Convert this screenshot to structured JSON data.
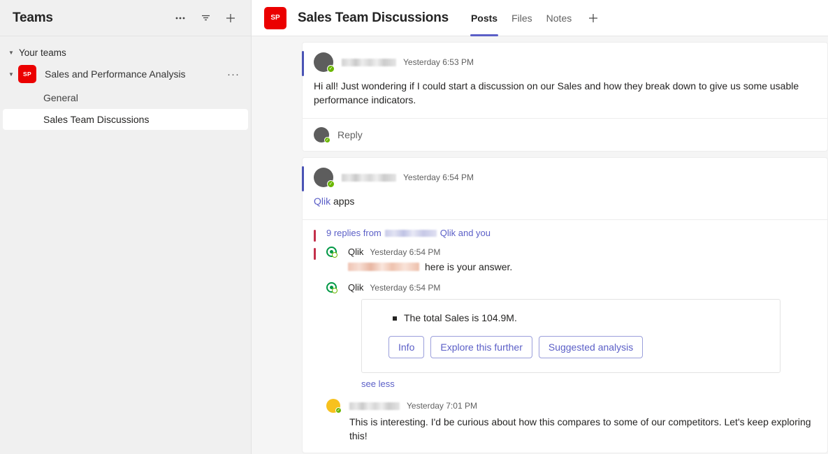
{
  "sidebar": {
    "title": "Teams",
    "actions": [
      {
        "name": "more-options-icon",
        "glyph": "···"
      },
      {
        "name": "filter-icon",
        "glyph": "filter"
      },
      {
        "name": "add-team-icon",
        "glyph": "+"
      }
    ],
    "group_label": "Your teams",
    "team": {
      "initials": "SP",
      "name": "Sales and Performance Analysis",
      "more_label": "···",
      "avatar_color": "#eb0000"
    },
    "channels": [
      {
        "label": "General",
        "selected": false
      },
      {
        "label": "Sales Team Discussions",
        "selected": true
      }
    ]
  },
  "header": {
    "avatar_initials": "SP",
    "title": "Sales Team Discussions",
    "tabs": [
      {
        "label": "Posts",
        "active": true
      },
      {
        "label": "Files",
        "active": false
      },
      {
        "label": "Notes",
        "active": false
      }
    ],
    "add_tab_glyph": "+",
    "accent_color": "#5b5fc7"
  },
  "conversation": {
    "messages": [
      {
        "author_blurred": true,
        "timestamp": "Yesterday 6:53 PM",
        "text": "Hi all! Just wondering if I could start a discussion on our Sales and how they break down to give us some usable performance indicators.",
        "reply_label": "Reply"
      },
      {
        "author_blurred": true,
        "timestamp": "Yesterday 6:54 PM",
        "text_link": "Qlik",
        "text_rest": " apps"
      }
    ],
    "thread": {
      "replies_prefix": "9 replies from",
      "replies_suffix": "Qlik and you",
      "replies": [
        {
          "author": "Qlik",
          "timestamp": "Yesterday 6:54 PM",
          "text": "here is your answer.",
          "mention_blurred": true
        },
        {
          "author": "Qlik",
          "timestamp": "Yesterday 6:54 PM",
          "card": {
            "bullet": "The total Sales is 104.9M.",
            "buttons": [
              "Info",
              "Explore this further",
              "Suggested analysis"
            ]
          },
          "see_less": "see less"
        }
      ],
      "last_message": {
        "author_blurred": true,
        "timestamp": "Yesterday 7:01 PM",
        "text": "This is interesting. I'd be curious about how this compares to some of our competitors. Let's keep exploring this!"
      }
    }
  }
}
